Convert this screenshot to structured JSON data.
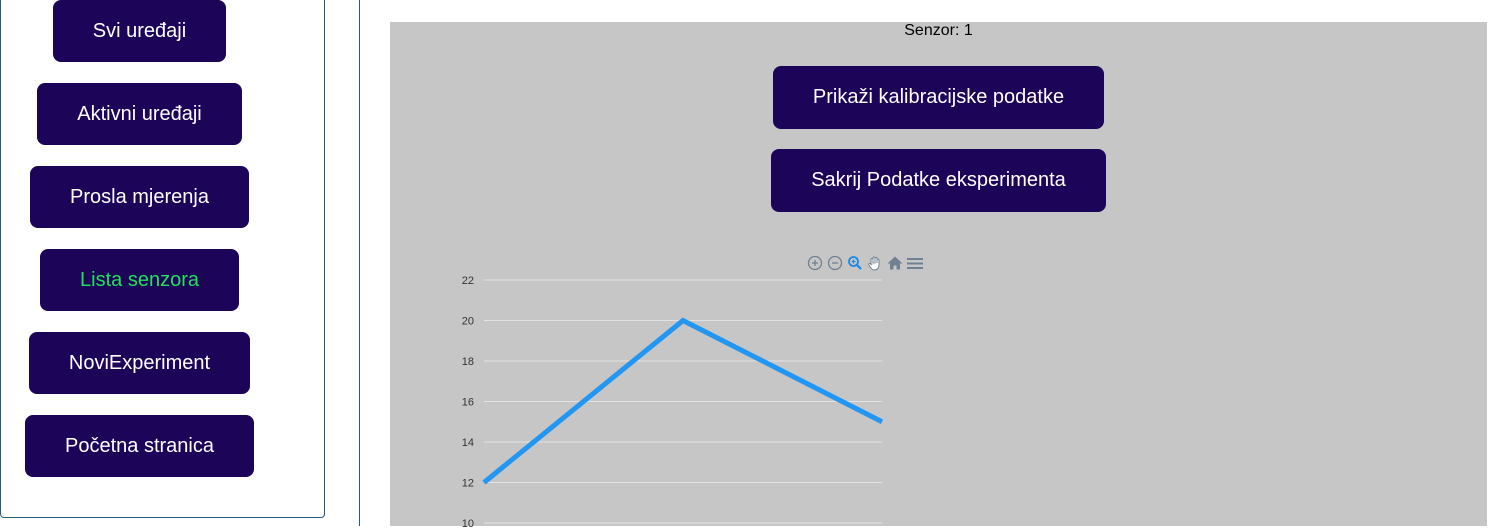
{
  "sidebar": {
    "items": [
      {
        "label": "Svi uređaji",
        "active": false
      },
      {
        "label": "Aktivni uređaji",
        "active": false
      },
      {
        "label": "Prosla mjerenja",
        "active": false
      },
      {
        "label": "Lista senzora",
        "active": true
      },
      {
        "label": "NoviExperiment",
        "active": false
      },
      {
        "label": "Početna stranica",
        "active": false
      }
    ],
    "active_color": "#22e05a",
    "button_color": "#1c0459"
  },
  "main": {
    "sensor_label": "Senzor: 1",
    "show_calibration_button": "Prikaži kalibracijske podatke",
    "hide_experiment_button": "Sakrij Podatke eksperimenta",
    "toolbar": {
      "icons": [
        "zoom-in-icon",
        "zoom-out-icon",
        "zoom-selection-icon",
        "pan-icon",
        "reset-home-icon",
        "menu-icon"
      ]
    }
  },
  "chart_data": {
    "type": "line",
    "x": [
      1,
      2,
      3
    ],
    "series": [
      {
        "values": [
          12,
          20,
          15
        ],
        "color": "#2196f3"
      }
    ],
    "yticks": [
      "22",
      "20",
      "18",
      "16",
      "14",
      "12",
      "10"
    ],
    "ylim": [
      10,
      22
    ],
    "grid": true
  }
}
